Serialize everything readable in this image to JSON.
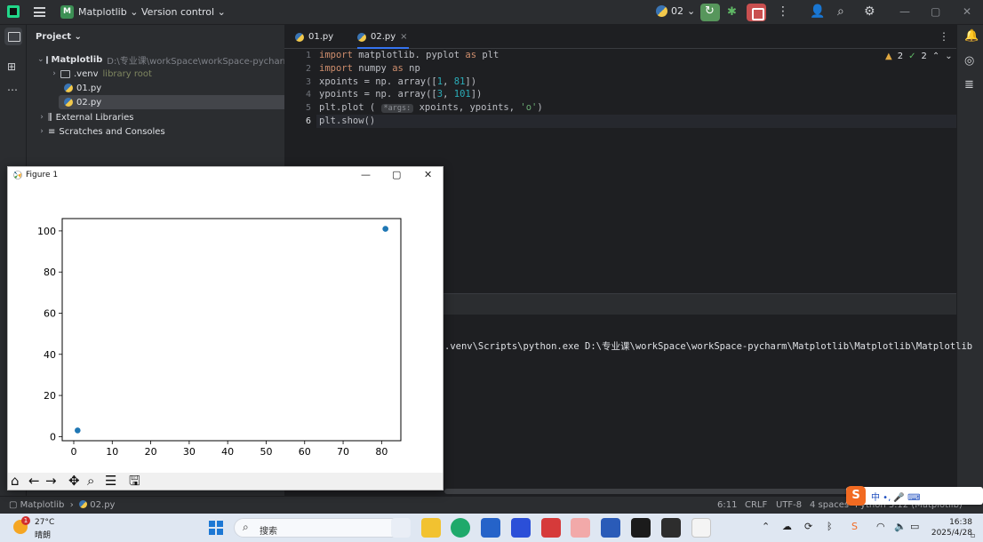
{
  "titlebar": {
    "project_badge": "M",
    "project_name": "Matplotlib",
    "version_control": "Version control",
    "run_config": "02"
  },
  "project_panel": {
    "header": "Project",
    "tree": [
      {
        "label": "Matplotlib",
        "note": "D:\\专业课\\workSpace\\workSpace-pycharm\\M"
      },
      {
        "label": ".venv",
        "note": "library root"
      },
      {
        "label": "01.py"
      },
      {
        "label": "02.py"
      },
      {
        "label": "External Libraries"
      },
      {
        "label": "Scratches and Consoles"
      }
    ]
  },
  "editor": {
    "tabs": [
      {
        "label": "01.py"
      },
      {
        "label": "02.py"
      }
    ],
    "line_numbers": [
      "1",
      "2",
      "3",
      "4",
      "5",
      "6"
    ],
    "inspection": {
      "warnings": "2",
      "ok": "2"
    },
    "code": {
      "l1_kw1": "import",
      "l1_mod": " matplotlib. pyplot ",
      "l1_kw2": "as",
      "l1_alias": " plt",
      "l2_kw1": "import",
      "l2_mod": " numpy ",
      "l2_kw2": "as",
      "l2_alias": " np",
      "l3_pre": "xpoints = np. array([",
      "l3_n1": "1",
      "l3_mid": ", ",
      "l3_n2": "81",
      "l3_post": "])",
      "l4_pre": "ypoints = np. array([",
      "l4_n1": "3",
      "l4_mid": ", ",
      "l4_n2": "101",
      "l4_post": "])",
      "l5_pre": "plt.plot ( ",
      "l5_hint": "*args:",
      "l5_mid": " xpoints, ypoints, ",
      "l5_str": "'o'",
      "l5_post": ")",
      "l6": "plt.show()"
    }
  },
  "run_output": {
    "text": ".venv\\Scripts\\python.exe D:\\专业课\\workSpace\\workSpace-pycharm\\Matplotlib\\Matplotlib\\Matplotlib"
  },
  "statusbar": {
    "breadcrumb_project": "Matplotlib",
    "breadcrumb_file": "02.py",
    "position": "6:11",
    "line_sep": "CRLF",
    "encoding": "UTF-8",
    "indent": "4 spaces",
    "interpreter": "Python 3.12 (Matplotlib)"
  },
  "figure_window": {
    "title": "Figure 1"
  },
  "chart_data": {
    "type": "scatter",
    "x": [
      1,
      81
    ],
    "y": [
      3,
      101
    ],
    "marker": "o",
    "color": "#1f77b4",
    "xticks": [
      "0",
      "10",
      "20",
      "30",
      "40",
      "50",
      "60",
      "70",
      "80"
    ],
    "yticks": [
      "0",
      "20",
      "40",
      "60",
      "80",
      "100"
    ],
    "xlim": [
      -3,
      85
    ],
    "ylim": [
      -2,
      106
    ],
    "grid": false,
    "title": "",
    "xlabel": "",
    "ylabel": ""
  },
  "ime": {
    "label": "中 •, 🎤 ⌨"
  },
  "taskbar": {
    "weather_badge": "1",
    "weather_temp": "27°C",
    "weather_desc": "晴朗",
    "search_placeholder": "搜索",
    "time": "16:38",
    "date": "2025/4/28"
  }
}
